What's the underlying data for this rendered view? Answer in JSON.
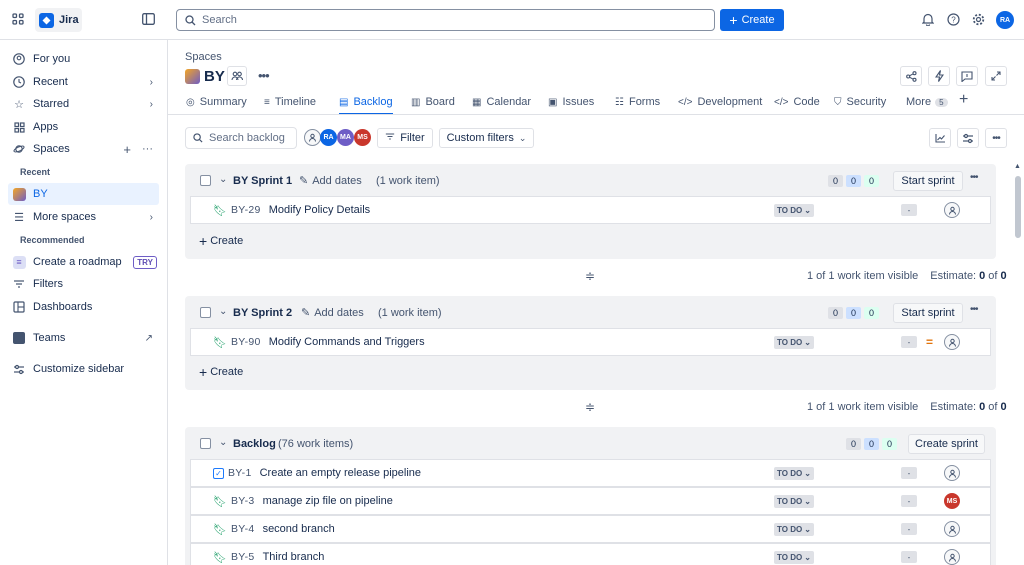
{
  "app": {
    "name": "Jira"
  },
  "search": {
    "placeholder": "Search"
  },
  "topbar": {
    "create_label": "Create",
    "user_initials": "RA"
  },
  "sidebar": {
    "for_you": "For you",
    "recent": "Recent",
    "starred": "Starred",
    "apps": "Apps",
    "spaces": "Spaces",
    "recent_header": "Recent",
    "by": "BY",
    "more_spaces": "More spaces",
    "recommended_header": "Recommended",
    "create_roadmap": "Create a roadmap",
    "try_badge": "TRY",
    "filters": "Filters",
    "dashboards": "Dashboards",
    "teams": "Teams",
    "customize": "Customize sidebar"
  },
  "header": {
    "breadcrumb": "Spaces",
    "project": "BY"
  },
  "tabs": [
    {
      "label": "Summary"
    },
    {
      "label": "Timeline"
    },
    {
      "label": "Backlog"
    },
    {
      "label": "Board"
    },
    {
      "label": "Calendar"
    },
    {
      "label": "Issues"
    },
    {
      "label": "Forms"
    },
    {
      "label": "Development"
    },
    {
      "label": "Code"
    },
    {
      "label": "Security"
    },
    {
      "label": "More",
      "badge": "5"
    }
  ],
  "toolbar": {
    "search_placeholder": "Search backlog",
    "avatars": [
      "RA",
      "MA",
      "MS"
    ],
    "filter_label": "Filter",
    "custom_filters_label": "Custom filters"
  },
  "sprint1": {
    "name": "BY Sprint 1",
    "add_dates": "Add dates",
    "count": "(1 work item)",
    "c1": "0",
    "c2": "0",
    "c3": "0",
    "action": "Start sprint",
    "items": [
      {
        "key": "BY-29",
        "summary": "Modify Policy Details",
        "status": "TO DO",
        "estimate": "-"
      }
    ],
    "create": "Create",
    "visible": "1 of 1 work item visible",
    "estimate_label": "Estimate:",
    "estimate_value": "0",
    "estimate_of": "of",
    "estimate_total": "0"
  },
  "sprint2": {
    "name": "BY Sprint 2",
    "add_dates": "Add dates",
    "count": "(1 work item)",
    "c1": "0",
    "c2": "0",
    "c3": "0",
    "action": "Start sprint",
    "items": [
      {
        "key": "BY-90",
        "summary": "Modify Commands and Triggers",
        "status": "TO DO",
        "estimate": "-"
      }
    ],
    "create": "Create",
    "visible": "1 of 1 work item visible",
    "estimate_label": "Estimate:",
    "estimate_value": "0",
    "estimate_of": "of",
    "estimate_total": "0"
  },
  "backlog": {
    "name": "Backlog",
    "count": "(76 work items)",
    "c1": "0",
    "c2": "0",
    "c3": "0",
    "action": "Create sprint",
    "items": [
      {
        "key": "BY-1",
        "summary": "Create an empty release pipeline",
        "status": "TO DO",
        "estimate": "-"
      },
      {
        "key": "BY-3",
        "summary": "manage zip file on pipeline",
        "status": "TO DO",
        "estimate": "-",
        "assignee": "MS"
      },
      {
        "key": "BY-4",
        "summary": "second branch",
        "status": "TO DO",
        "estimate": "-"
      },
      {
        "key": "BY-5",
        "summary": "Third branch",
        "status": "TO DO",
        "estimate": "-"
      }
    ]
  },
  "colors": {
    "accent": "#0c66e4",
    "ra": "#0c66e4",
    "ma": "#6e5dc6",
    "ms": "#c9372c"
  }
}
